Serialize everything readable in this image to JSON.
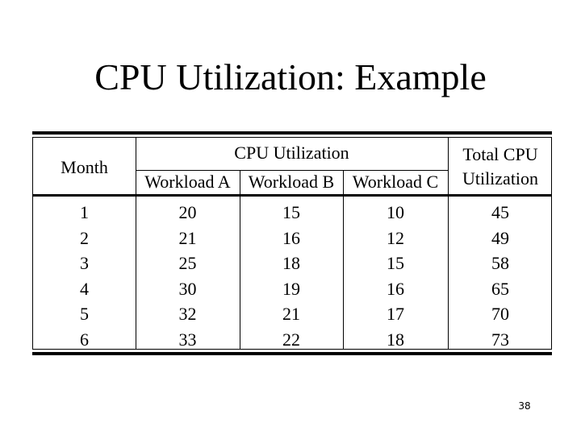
{
  "slide": {
    "title": "CPU Utilization: Example",
    "page_number": "38"
  },
  "table": {
    "headers": {
      "month": "Month",
      "group": "CPU Utilization",
      "workload_a": "Workload A",
      "workload_b": "Workload B",
      "workload_c": "Workload C",
      "total_line1": "Total CPU",
      "total_line2": "Utilization"
    },
    "rows": [
      {
        "month": "1",
        "a": "20",
        "b": "15",
        "c": "10",
        "total": "45"
      },
      {
        "month": "2",
        "a": "21",
        "b": "16",
        "c": "12",
        "total": "49"
      },
      {
        "month": "3",
        "a": "25",
        "b": "18",
        "c": "15",
        "total": "58"
      },
      {
        "month": "4",
        "a": "30",
        "b": "19",
        "c": "16",
        "total": "65"
      },
      {
        "month": "5",
        "a": "32",
        "b": "21",
        "c": "17",
        "total": "70"
      },
      {
        "month": "6",
        "a": "33",
        "b": "22",
        "c": "18",
        "total": "73"
      }
    ]
  }
}
